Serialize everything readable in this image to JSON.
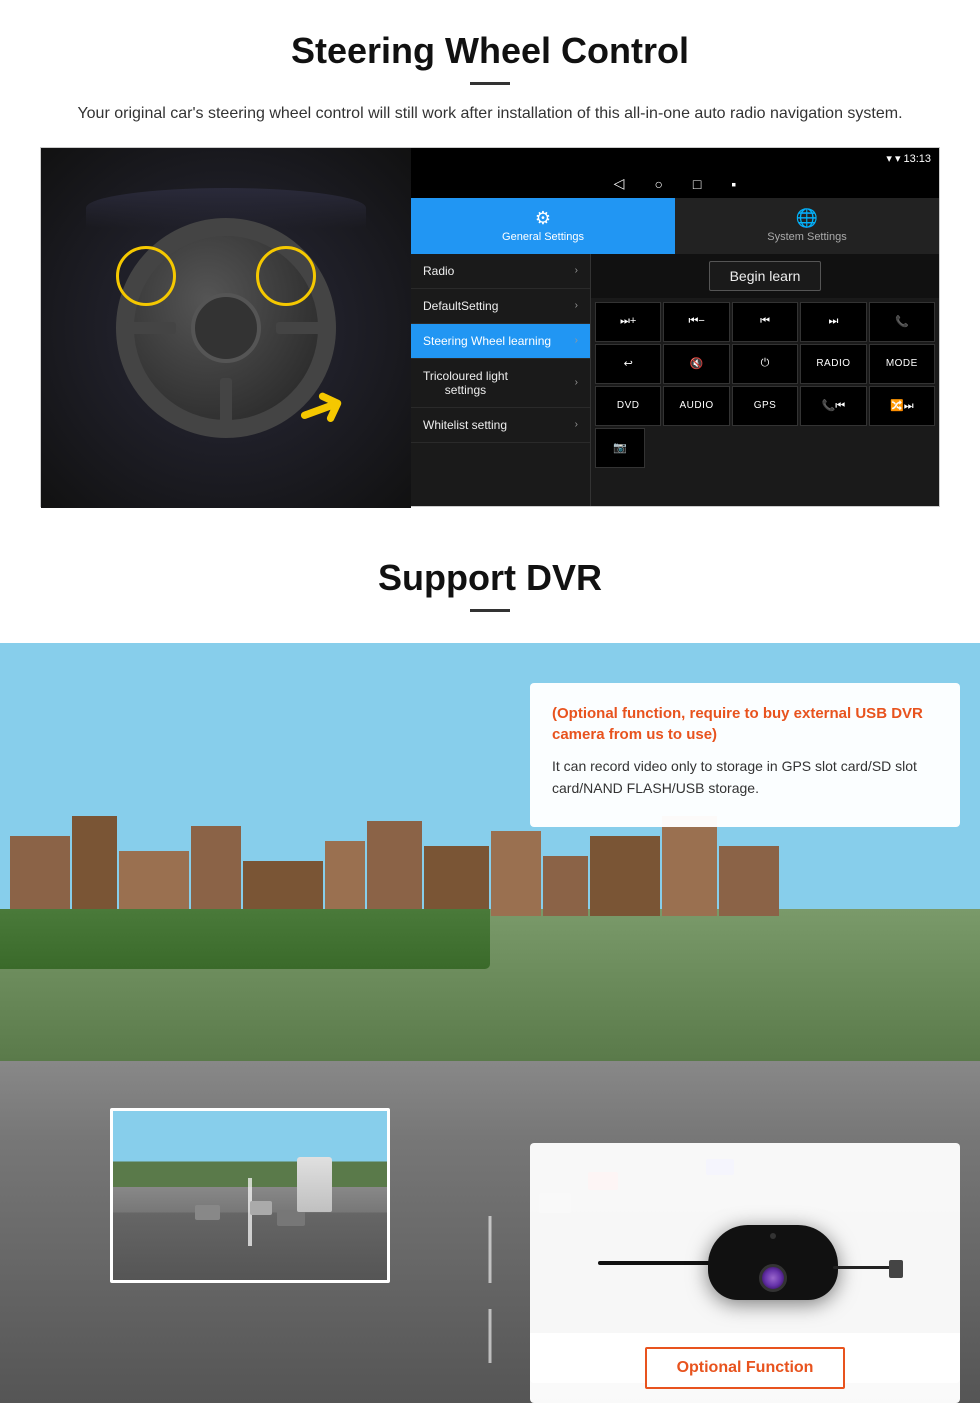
{
  "steering": {
    "title": "Steering Wheel Control",
    "subtitle": "Your original car's steering wheel control will still work after installation of this all-in-one auto radio navigation system.",
    "android_status": {
      "time": "13:13",
      "signal": "▼",
      "wifi": "▾"
    },
    "tabs": [
      {
        "label": "General Settings",
        "icon": "⚙",
        "active": true
      },
      {
        "label": "System Settings",
        "icon": "🌐",
        "active": false
      }
    ],
    "menu_items": [
      {
        "label": "Radio",
        "active": false
      },
      {
        "label": "DefaultSetting",
        "active": false
      },
      {
        "label": "Steering Wheel learning",
        "active": true
      },
      {
        "label": "Tricoloured light settings",
        "active": false
      },
      {
        "label": "Whitelist setting",
        "active": false
      }
    ],
    "begin_learn_label": "Begin learn",
    "control_buttons": [
      [
        "⏭+",
        "⏮−",
        "⏮⏮",
        "⏭⏭",
        "📞"
      ],
      [
        "↩",
        "🔇",
        "⏻",
        "RADIO",
        "MODE"
      ],
      [
        "DVD",
        "AUDIO",
        "GPS",
        "📞⏮",
        "🔀⏭"
      ],
      [
        "📷"
      ]
    ]
  },
  "dvr": {
    "title": "Support DVR",
    "optional_text": "(Optional function, require to buy external USB DVR camera from us to use)",
    "description": "It can record video only to storage in GPS slot card/SD slot card/NAND FLASH/USB storage.",
    "optional_function_label": "Optional Function"
  }
}
